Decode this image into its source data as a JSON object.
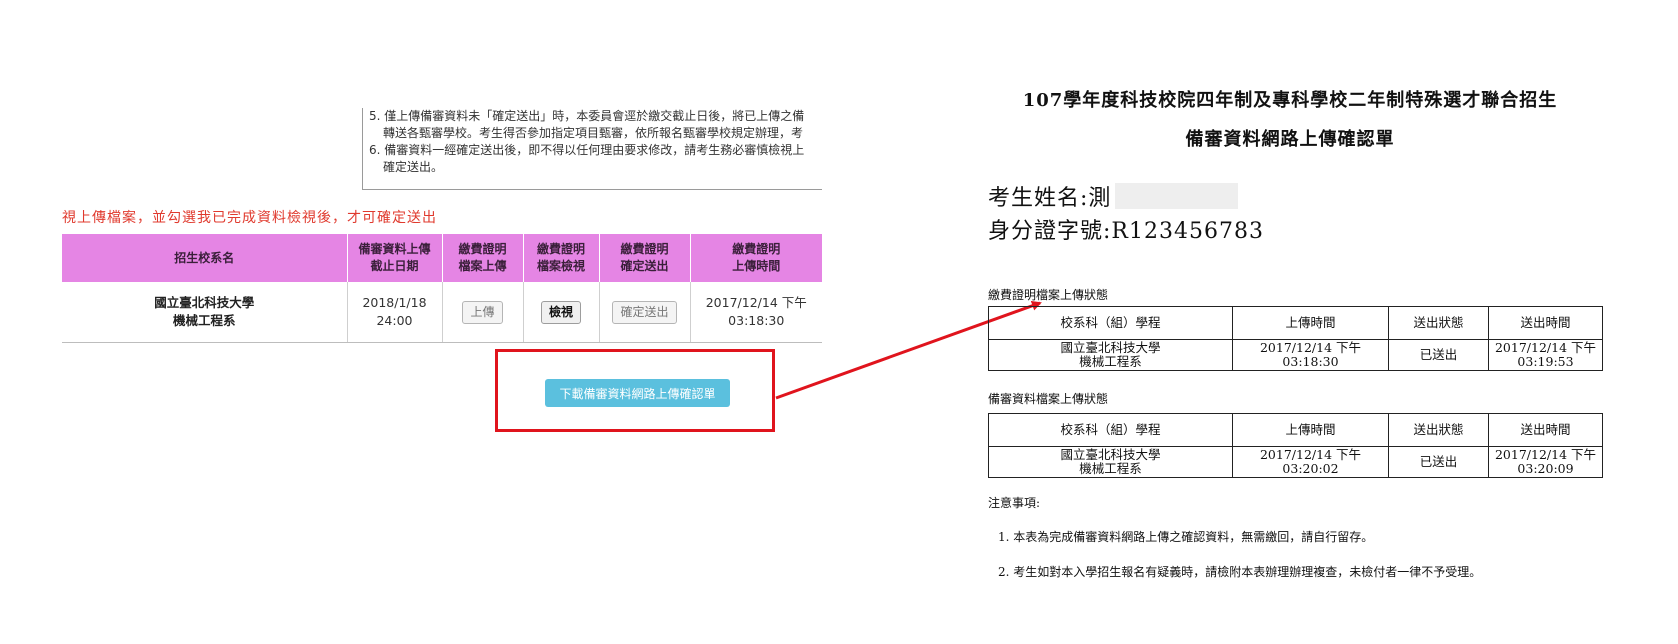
{
  "web": {
    "notes": [
      "5. 僅上傳備審資料未「確定送出」時，本委員會逕於繳交截止日後，將已上傳之備",
      "轉送各甄審學校。考生得否參加指定項目甄審，依所報名甄審學校規定辦理，考",
      "6. 備審資料一經確定送出後，即不得以任何理由要求修改，請考生務必審慎檢視上",
      "確定送出。"
    ],
    "warning": "視上傳檔案，並勾選我已完成資料檢視後，才可確定送出",
    "table": {
      "headers": [
        [
          "招生校系名"
        ],
        [
          "備審資料上傳",
          "截止日期"
        ],
        [
          "繳費證明",
          "檔案上傳"
        ],
        [
          "繳費證明",
          "檔案檢視"
        ],
        [
          "繳費證明",
          "確定送出"
        ],
        [
          "繳費證明",
          "上傳時間"
        ]
      ],
      "row": {
        "school": "國立臺北科技大學",
        "dept": "機械工程系",
        "deadline_date": "2018/1/18",
        "deadline_time": "24:00",
        "upload_btn": "上傳",
        "view_btn": "檢視",
        "confirm_btn": "確定送出",
        "upload_date": "2017/12/14 下午",
        "upload_time": "03:18:30"
      }
    },
    "download_button": "下載備審資料網路上傳確認單",
    "colors": {
      "header_bg": "#e585e4",
      "warning": "#e03a2e",
      "download_btn": "#5bc0de",
      "annotation": "#e0141d"
    }
  },
  "doc": {
    "title_line1": "107學年度科技校院四年制及專科學校二年制特殊選才聯合招生",
    "title_line2": "備審資料網路上傳確認單",
    "name_label": "考生姓名:",
    "name_value": "測",
    "id_label": "身分證字號:",
    "id_value": "R123456783",
    "payment_section": "繳費證明檔案上傳狀態",
    "review_section": "備審資料檔案上傳狀態",
    "columns": [
      "校系科（組）學程",
      "上傳時間",
      "送出狀態",
      "送出時間"
    ],
    "payment_row": {
      "school": "國立臺北科技大學",
      "dept": "機械工程系",
      "upload_date": "2017/12/14 下午",
      "upload_time": "03:18:30",
      "status": "已送出",
      "sent_date": "2017/12/14 下午",
      "sent_time": "03:19:53"
    },
    "review_row": {
      "school": "國立臺北科技大學",
      "dept": "機械工程系",
      "upload_date": "2017/12/14 下午",
      "upload_time": "03:20:02",
      "status": "已送出",
      "sent_date": "2017/12/14 下午",
      "sent_time": "03:20:09"
    },
    "notes_title": "注意事項:",
    "notes": [
      "1. 本表為完成備審資料網路上傳之確認資料，無需繳回，請自行留存。",
      "2. 考生如對本入學招生報名有疑義時，請檢附本表辦理辦理複查，未檢付者一律不予受理。"
    ]
  }
}
